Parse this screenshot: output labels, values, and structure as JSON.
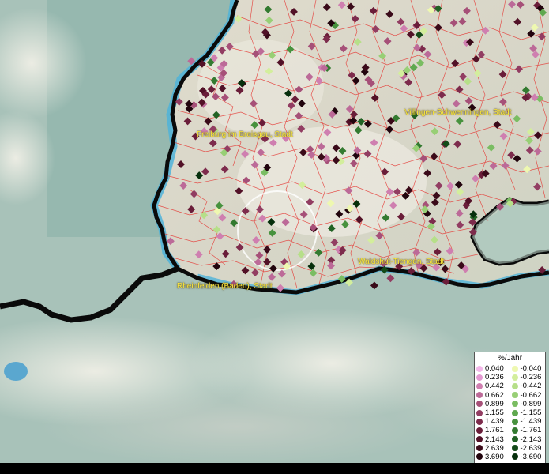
{
  "cities": [
    {
      "name": "Freiburg im Breisgau, Stadt"
    },
    {
      "name": "Villingen-Schwenningen, Stadt"
    },
    {
      "name": "Waldshut-Tiengen, Stadt"
    },
    {
      "name": "Rheinfelden (Baden), Stadt"
    }
  ],
  "legend": {
    "title": "%/Jahr",
    "positive": [
      {
        "label": "0.040",
        "color": "#f3b7ea"
      },
      {
        "label": "0.236",
        "color": "#e49ad3"
      },
      {
        "label": "0.442",
        "color": "#cf7fb0"
      },
      {
        "label": "0.662",
        "color": "#bc6a98"
      },
      {
        "label": "0.899",
        "color": "#a65078"
      },
      {
        "label": "1.155",
        "color": "#923d62"
      },
      {
        "label": "1.439",
        "color": "#7d2b4c"
      },
      {
        "label": "1.761",
        "color": "#6a1d39"
      },
      {
        "label": "2.143",
        "color": "#521127"
      },
      {
        "label": "2.639",
        "color": "#3a0a19"
      },
      {
        "label": "3.690",
        "color": "#21040d"
      }
    ],
    "negative": [
      {
        "label": "-0.040",
        "color": "#eef8b0"
      },
      {
        "label": "-0.236",
        "color": "#d3ee9c"
      },
      {
        "label": "-0.442",
        "color": "#b6df89"
      },
      {
        "label": "-0.662",
        "color": "#98cf75"
      },
      {
        "label": "-0.899",
        "color": "#7abd62"
      },
      {
        "label": "-1.155",
        "color": "#5fa84f"
      },
      {
        "label": "-1.439",
        "color": "#47923e"
      },
      {
        "label": "-1.761",
        "color": "#337a30"
      },
      {
        "label": "-2.143",
        "color": "#226224"
      },
      {
        "label": "-2.639",
        "color": "#134a18"
      },
      {
        "label": "-3.690",
        "color": "#062f0c"
      }
    ]
  },
  "colors": {
    "border": "#0a0a0a",
    "river": "#4fb3d9",
    "municipality_lines": "#e53935",
    "label": "#ffeb3b"
  }
}
